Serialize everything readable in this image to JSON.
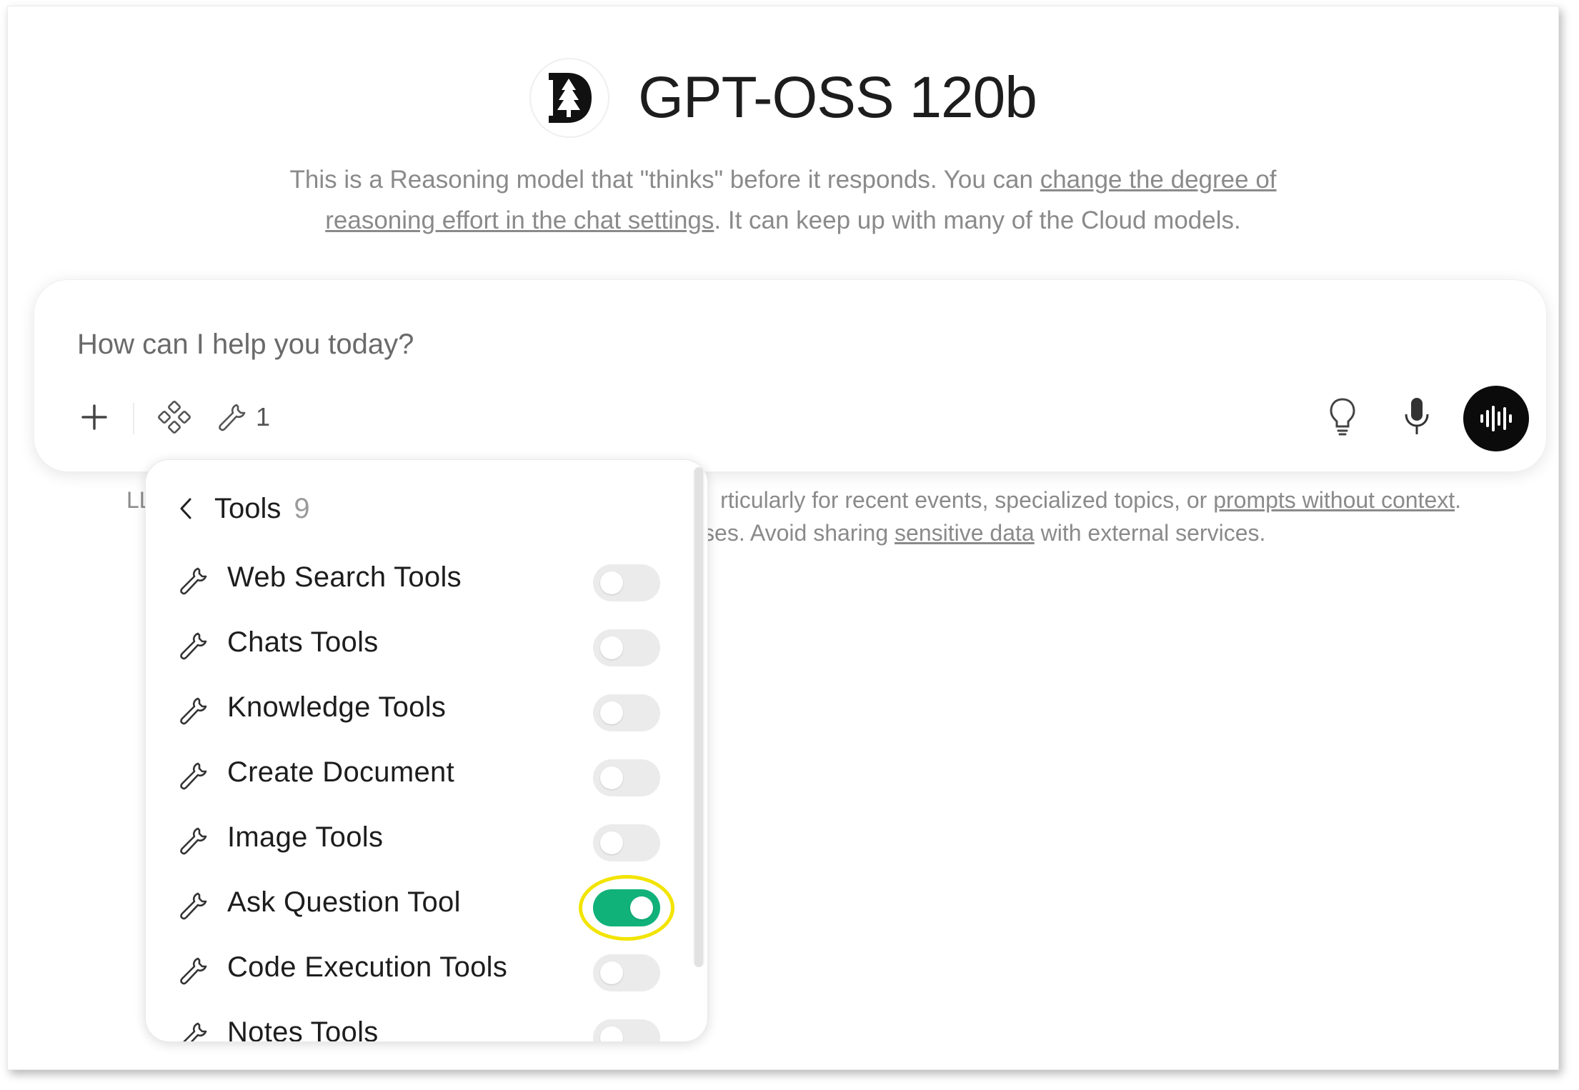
{
  "header": {
    "model_title": "GPT-OSS 120b",
    "logo_icon": "tree-logo-icon"
  },
  "subtitle": {
    "line1_pre": "This is a Reasoning model that \"thinks\" before it responds. You can ",
    "line1_link": "change the degree of",
    "line2_link": "reasoning effort in the chat settings",
    "line2_post": ". It can keep up with many of the Cloud models."
  },
  "chat": {
    "placeholder": "How can I help you today?",
    "tools_count": "1",
    "icons": {
      "plus": "plus-icon",
      "integrations": "integrations-icon",
      "tools": "wrench-icon",
      "lightbulb": "lightbulb-icon",
      "mic": "microphone-icon",
      "voice": "voice-waveform-icon"
    }
  },
  "disclaimer": {
    "prefix": "LLM",
    "line1_post": "rticularly for recent events, specialized topics, or ",
    "line1_link": "prompts without context",
    "line1_end": ".",
    "line2_pre": "ponses. Avoid sharing ",
    "line2_link": "sensitive data",
    "line2_post": " with external services."
  },
  "tools_menu": {
    "title": "Tools",
    "count": "9",
    "items": [
      {
        "label": "Web Search Tools",
        "enabled": false
      },
      {
        "label": "Chats Tools",
        "enabled": false
      },
      {
        "label": "Knowledge Tools",
        "enabled": false
      },
      {
        "label": "Create Document",
        "enabled": false
      },
      {
        "label": "Image Tools",
        "enabled": false
      },
      {
        "label": "Ask Question Tool",
        "enabled": true,
        "highlighted": true
      },
      {
        "label": "Code Execution Tools",
        "enabled": false
      },
      {
        "label": "Notes Tools",
        "enabled": false
      }
    ]
  },
  "colors": {
    "toggle_on": "#10b27a",
    "toggle_off": "#ebebeb",
    "highlight": "#f2e400",
    "voice_button": "#0b0b0b"
  }
}
